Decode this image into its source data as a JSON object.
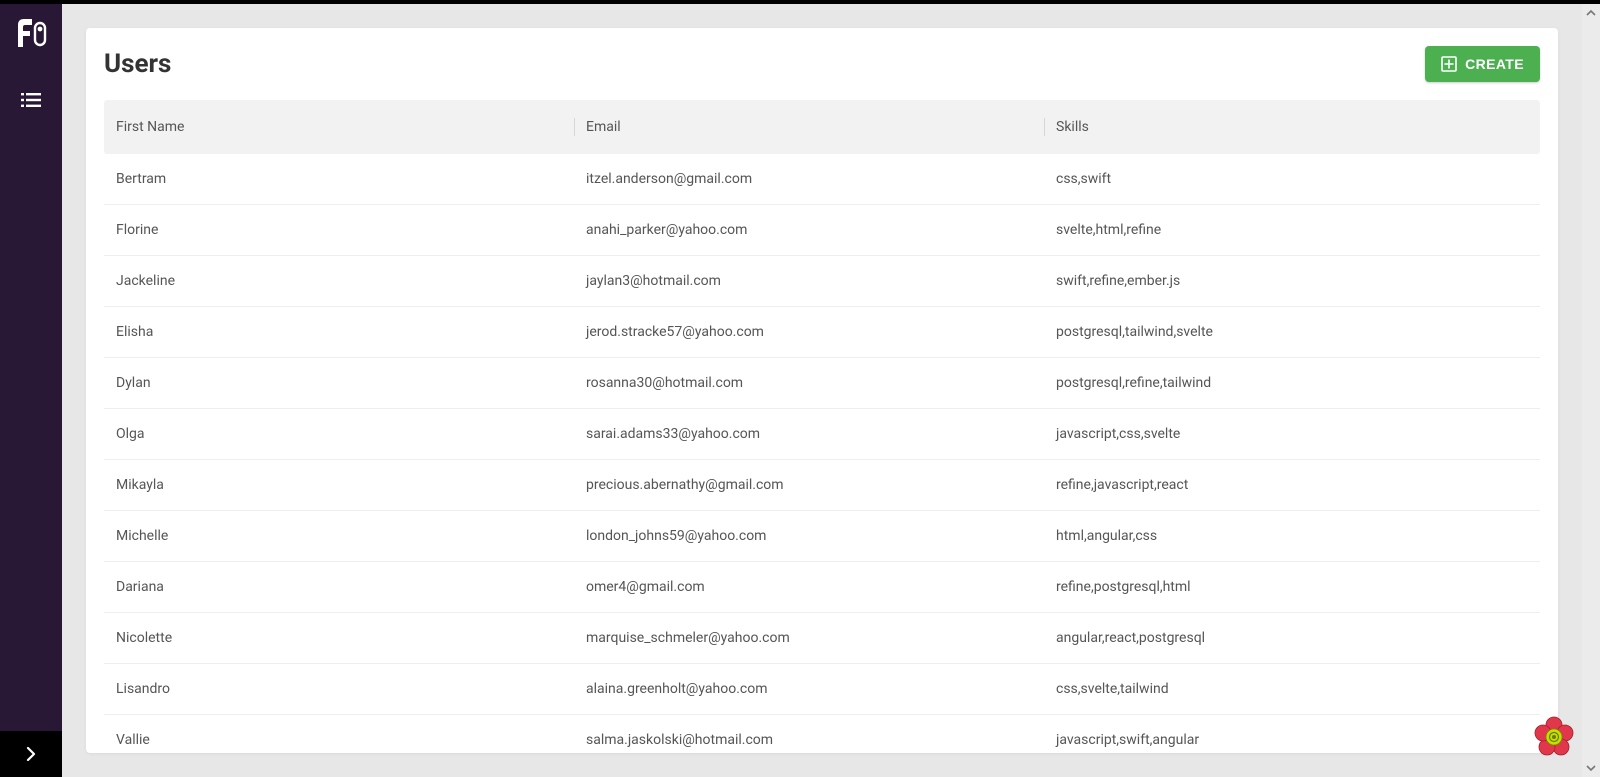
{
  "page": {
    "title": "Users"
  },
  "sidebar": {
    "items": [
      {
        "icon": "list-icon",
        "name": "sidebar-item-users"
      }
    ]
  },
  "actions": {
    "create_label": "CREATE"
  },
  "table": {
    "columns": [
      {
        "key": "first_name",
        "label": "First Name"
      },
      {
        "key": "email",
        "label": "Email"
      },
      {
        "key": "skills",
        "label": "Skills"
      }
    ],
    "rows": [
      {
        "first_name": "Bertram",
        "email": "itzel.anderson@gmail.com",
        "skills": "css,swift"
      },
      {
        "first_name": "Florine",
        "email": "anahi_parker@yahoo.com",
        "skills": "svelte,html,refine"
      },
      {
        "first_name": "Jackeline",
        "email": "jaylan3@hotmail.com",
        "skills": "swift,refine,ember.js"
      },
      {
        "first_name": "Elisha",
        "email": "jerod.stracke57@yahoo.com",
        "skills": "postgresql,tailwind,svelte"
      },
      {
        "first_name": "Dylan",
        "email": "rosanna30@hotmail.com",
        "skills": "postgresql,refine,tailwind"
      },
      {
        "first_name": "Olga",
        "email": "sarai.adams33@yahoo.com",
        "skills": "javascript,css,svelte"
      },
      {
        "first_name": "Mikayla",
        "email": "precious.abernathy@gmail.com",
        "skills": "refine,javascript,react"
      },
      {
        "first_name": "Michelle",
        "email": "london_johns59@yahoo.com",
        "skills": "html,angular,css"
      },
      {
        "first_name": "Dariana",
        "email": "omer4@gmail.com",
        "skills": "refine,postgresql,html"
      },
      {
        "first_name": "Nicolette",
        "email": "marquise_schmeler@yahoo.com",
        "skills": "angular,react,postgresql"
      },
      {
        "first_name": "Lisandro",
        "email": "alaina.greenholt@yahoo.com",
        "skills": "css,svelte,tailwind"
      },
      {
        "first_name": "Vallie",
        "email": "salma.jaskolski@hotmail.com",
        "skills": "javascript,swift,angular"
      }
    ]
  },
  "colors": {
    "sidebar": "#281835",
    "accent": "#4caf50",
    "badge_primary": "#e1374a",
    "badge_secondary": "#c3e000"
  }
}
